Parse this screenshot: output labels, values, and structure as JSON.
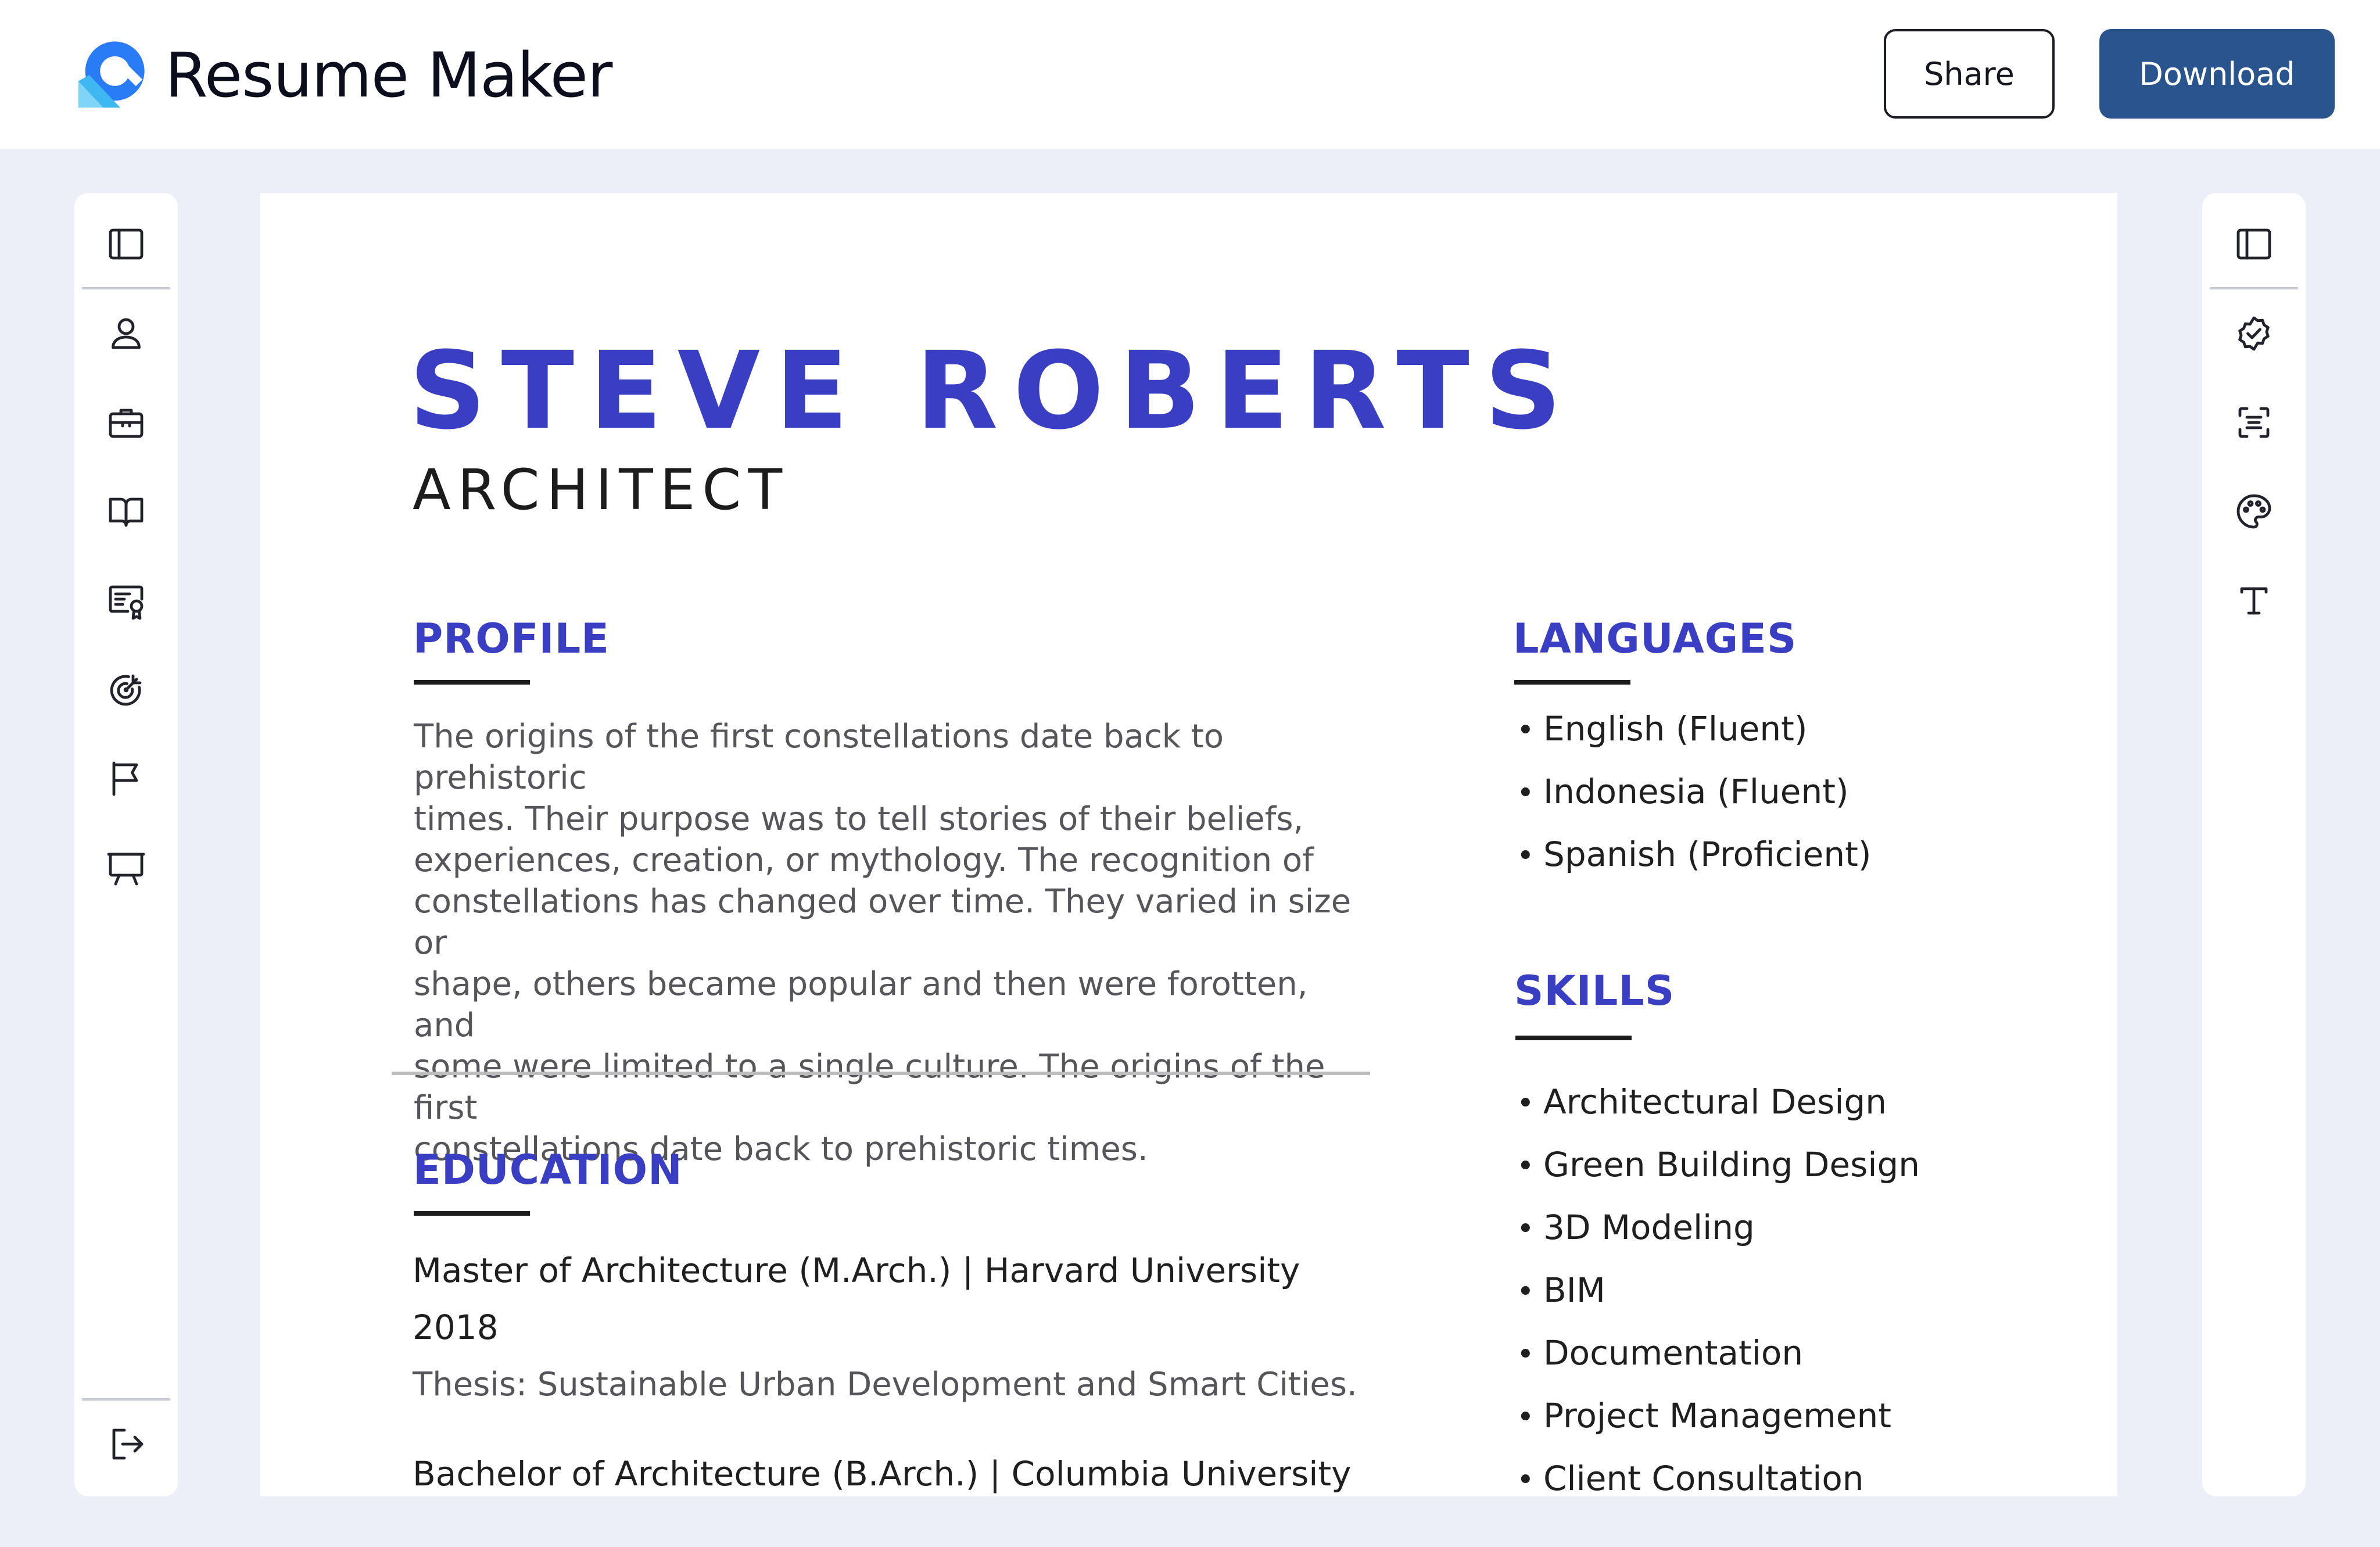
{
  "app": {
    "name": "Resume Maker",
    "share_label": "Share",
    "download_label": "Download",
    "brand_color": "#2a7cf6",
    "download_color": "#29548d"
  },
  "left_toolbar": {
    "items": [
      {
        "icon": "sidebar-panel-icon"
      },
      {
        "icon": "user-icon"
      },
      {
        "icon": "briefcase-icon"
      },
      {
        "icon": "book-open-icon"
      },
      {
        "icon": "certificate-icon"
      },
      {
        "icon": "target-icon"
      },
      {
        "icon": "flag-icon"
      },
      {
        "icon": "presentation-icon"
      },
      {
        "icon": "logout-icon"
      }
    ]
  },
  "right_toolbar": {
    "items": [
      {
        "icon": "sidebar-panel-icon"
      },
      {
        "icon": "badge-check-icon"
      },
      {
        "icon": "scan-text-icon"
      },
      {
        "icon": "palette-icon"
      },
      {
        "icon": "text-type-icon"
      }
    ]
  },
  "resume": {
    "name": "STEVE ROBERTS",
    "title": "ARCHITECT",
    "accent_color": "#3a3ec2",
    "profile": {
      "heading": "PROFILE",
      "lines": [
        "The origins of the first constellations date back to prehistoric",
        "times. Their purpose was to tell stories of their beliefs,",
        "experiences, creation, or mythology. The recognition of",
        "constellations has changed over time. They varied in size or",
        "shape, others became popular and then were forotten, and",
        "some were limited to a single culture. The origins of the first",
        "constellations date back to prehistoric times."
      ]
    },
    "education": {
      "heading": "EDUCATION",
      "entries": [
        {
          "degree": "Master of Architecture (M.Arch.) | Harvard University",
          "year": "2018",
          "note": "Thesis: Sustainable Urban Development and Smart Cities."
        },
        {
          "degree": "Bachelor of Architecture (B.Arch.) | Columbia University"
        }
      ]
    },
    "languages": {
      "heading": "LANGUAGES",
      "items": [
        "English (Fluent)",
        "Indonesia (Fluent)",
        "Spanish (Proficient)"
      ]
    },
    "skills": {
      "heading": "SKILLS",
      "items": [
        "Architectural Design",
        "Green Building Design",
        "3D Modeling",
        "BIM",
        "Documentation",
        "Project Management",
        "Client Consultation"
      ]
    }
  }
}
